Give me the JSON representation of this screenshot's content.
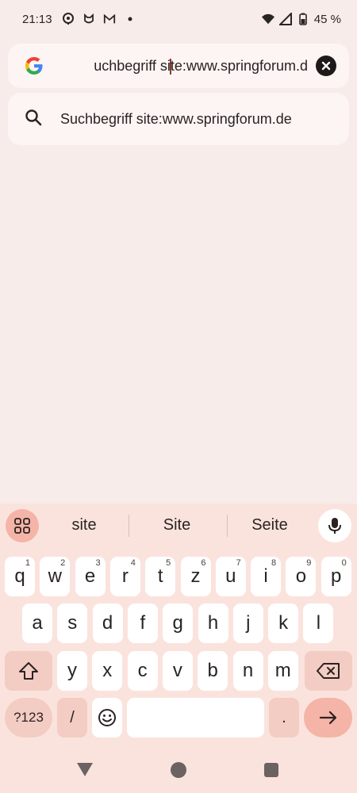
{
  "status": {
    "time": "21:13",
    "battery": "45 %",
    "icons": [
      "location-pin-icon",
      "shield-cat-icon",
      "gmail-icon",
      "dot-icon",
      "wifi-icon",
      "signal-icon",
      "battery-icon"
    ]
  },
  "search": {
    "query_visible": "uchbegriff site:www.springforum.d",
    "query_before_cursor": "uchbegriff si",
    "query_after_cursor": "te:www.springforum.d",
    "clear_icon": "close-icon",
    "logo": "google-g-logo"
  },
  "suggestions": [
    {
      "text": "Suchbegriff site:www.springforum.de",
      "icon": "search-icon"
    }
  ],
  "keyboard": {
    "word_suggestions": [
      "site",
      "Site",
      "Seite"
    ],
    "row1": [
      {
        "k": "q",
        "h": "1"
      },
      {
        "k": "w",
        "h": "2"
      },
      {
        "k": "e",
        "h": "3"
      },
      {
        "k": "r",
        "h": "4"
      },
      {
        "k": "t",
        "h": "5"
      },
      {
        "k": "z",
        "h": "6"
      },
      {
        "k": "u",
        "h": "7"
      },
      {
        "k": "i",
        "h": "8"
      },
      {
        "k": "o",
        "h": "9"
      },
      {
        "k": "p",
        "h": "0"
      }
    ],
    "row2": [
      "a",
      "s",
      "d",
      "f",
      "g",
      "h",
      "j",
      "k",
      "l"
    ],
    "row3": [
      "y",
      "x",
      "c",
      "v",
      "b",
      "n",
      "m"
    ],
    "symbols_label": "?123",
    "slash_label": "/",
    "period_label": ".",
    "accent_color": "#f4b4a7"
  },
  "nav": {
    "icons": [
      "back-triangle-icon",
      "home-circle-icon",
      "recents-square-icon"
    ]
  }
}
